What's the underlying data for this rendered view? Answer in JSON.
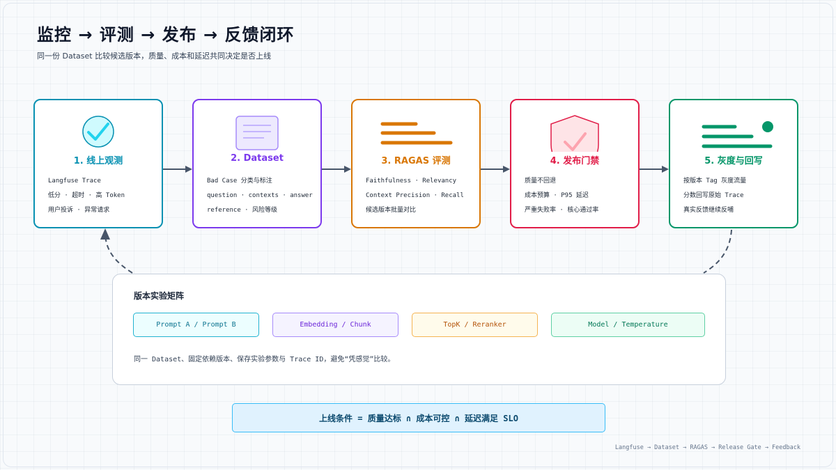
{
  "header": {
    "title": "监控 → 评测 → 发布 → 反馈闭环",
    "subtitle": "同一份 Dataset 比较候选版本，质量、成本和延迟共同决定是否上线"
  },
  "stages": [
    {
      "title": "1. 线上观测",
      "lines": [
        "Langfuse Trace",
        "低分 · 超时 · 高 Token",
        "用户投诉 · 异常请求"
      ],
      "color": "#0891b2",
      "icon": "check-circle-icon"
    },
    {
      "title": "2. Dataset",
      "lines": [
        "Bad Case 分类与标注",
        "question · contexts · answer",
        "reference · 风险等级"
      ],
      "color": "#7c3aed",
      "icon": "document-icon"
    },
    {
      "title": "3. RAGAS 评测",
      "lines": [
        "Faithfulness · Relevancy",
        "Context Precision · Recall",
        "候选版本批量对比"
      ],
      "color": "#d97706",
      "icon": "metric-bars-icon"
    },
    {
      "title": "4. 发布门禁",
      "lines": [
        "质量不回退",
        "成本预算 · P95 延迟",
        "严重失败率 · 核心通过率"
      ],
      "color": "#e11d48",
      "icon": "shield-check-icon"
    },
    {
      "title": "5. 灰度与回写",
      "lines": [
        "按版本 Tag 灰度流量",
        "分数回写原始 Trace",
        "真实反馈继续反哺"
      ],
      "color": "#059669",
      "icon": "rollout-bars-icon"
    }
  ],
  "matrix": {
    "title": "版本实验矩阵",
    "chips": [
      {
        "label": "Prompt A / Prompt B",
        "color": "#0e7490",
        "bg": "#ecfeff",
        "border": "#22b3d1"
      },
      {
        "label": "Embedding / Chunk",
        "color": "#6d28d9",
        "bg": "#f5f3ff",
        "border": "#a78bfa"
      },
      {
        "label": "TopK / Reranker",
        "color": "#b45309",
        "bg": "#fffbeb",
        "border": "#f5b453"
      },
      {
        "label": "Model / Temperature",
        "color": "#047857",
        "bg": "#ecfdf5",
        "border": "#5fd0a4"
      }
    ],
    "note": "同一 Dataset、固定依赖版本、保存实验参数与 Trace ID，避免“凭感觉”比较。"
  },
  "condition": "上线条件 = 质量达标 ∩ 成本可控 ∩ 延迟满足 SLO",
  "footer": "Langfuse → Dataset → RAGAS → Release Gate → Feedback"
}
